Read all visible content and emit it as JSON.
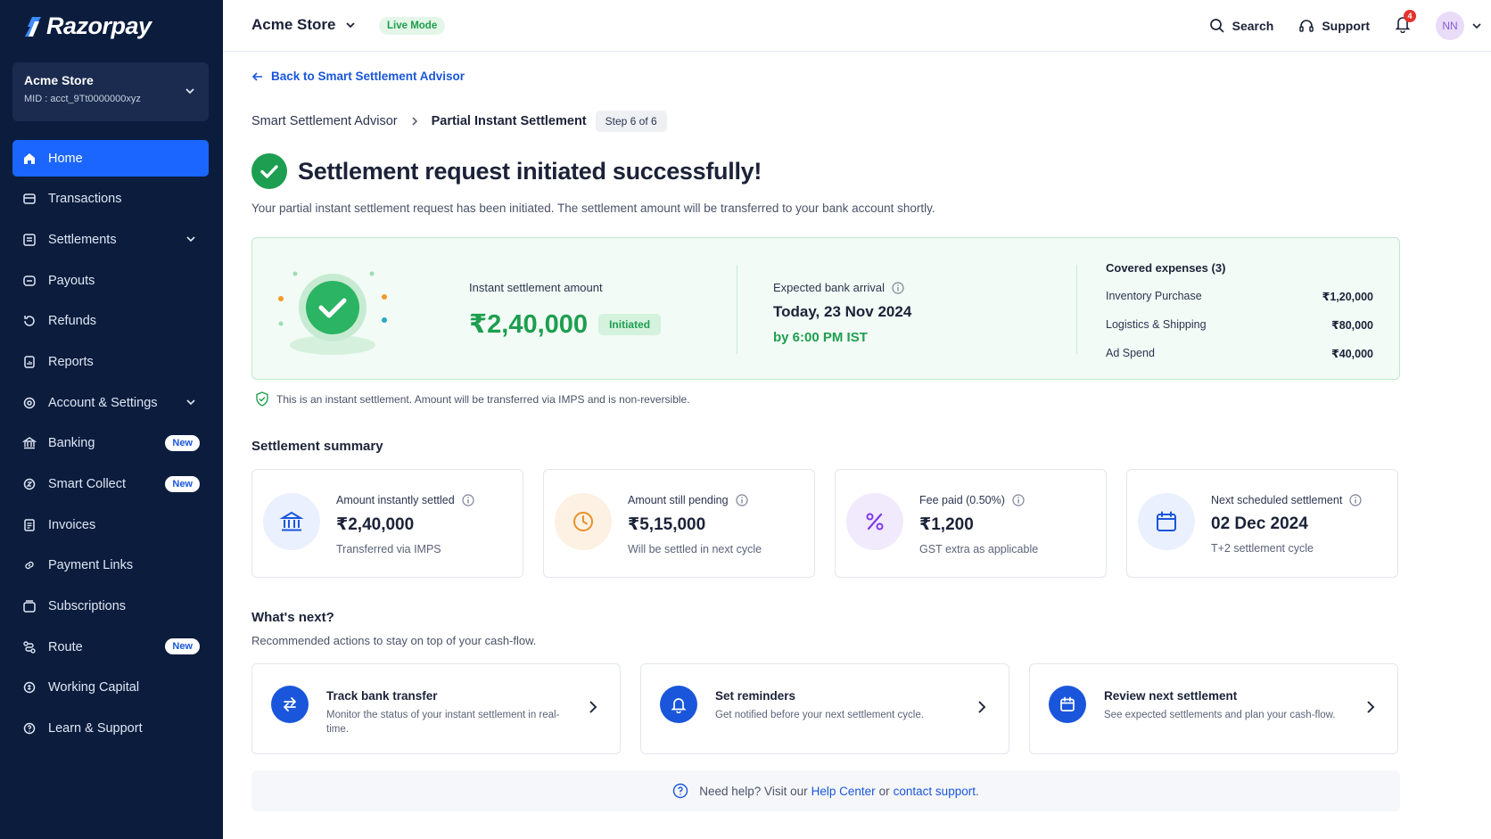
{
  "brand": {
    "name": "Razorpay"
  },
  "sidebar": {
    "store_name": "Acme Store",
    "store_mid": "MID : acct_9Tt0000000xyz",
    "items": [
      {
        "label": "Home",
        "icon": "home-icon",
        "active": true
      },
      {
        "label": "Transactions",
        "icon": "transactions-icon"
      },
      {
        "label": "Settlements",
        "icon": "settlements-icon",
        "expandable": true
      },
      {
        "label": "Payouts",
        "icon": "payouts-icon"
      },
      {
        "label": "Refunds",
        "icon": "refunds-icon"
      },
      {
        "label": "Reports",
        "icon": "reports-icon"
      },
      {
        "label": "Account & Settings",
        "icon": "settings-icon",
        "expandable": true
      },
      {
        "label": "Banking",
        "icon": "bank-icon",
        "badge": "New"
      },
      {
        "label": "Smart Collect",
        "icon": "smart-collect-icon",
        "badge": "New"
      },
      {
        "label": "Invoices",
        "icon": "invoice-icon"
      },
      {
        "label": "Payment Links",
        "icon": "link-icon"
      },
      {
        "label": "Subscriptions",
        "icon": "subscriptions-icon"
      },
      {
        "label": "Route",
        "icon": "route-icon",
        "badge": "New"
      },
      {
        "label": "Working Capital",
        "icon": "capital-icon"
      },
      {
        "label": "Learn & Support",
        "icon": "support-icon"
      }
    ]
  },
  "topbar": {
    "store_name": "Acme Store",
    "mode_badge": "Live Mode",
    "search_label": "Search",
    "support_label": "Support",
    "notification_count": "4",
    "avatar_initials": "NN"
  },
  "page": {
    "back_link": "Back to Smart Settlement Advisor",
    "breadcrumb": {
      "parent": "Smart Settlement Advisor",
      "current": "Partial Instant Settlement",
      "step": "Step 6 of 6"
    },
    "title": "Settlement request initiated successfully!",
    "subtitle": "Your partial instant settlement request has been initiated. The settlement amount will be transferred to your bank account shortly."
  },
  "hero": {
    "amount_label": "Instant settlement amount",
    "amount": "₹2,40,000",
    "status": "Initiated",
    "arrival_label": "Expected bank arrival",
    "arrival_date": "Today, 23 Nov 2024",
    "arrival_time": "by 6:00 PM IST",
    "expenses_label": "Covered expenses (3)",
    "expenses": [
      {
        "name": "Inventory Purchase",
        "amount": "₹1,20,000"
      },
      {
        "name": "Logistics & Shipping",
        "amount": "₹80,000"
      },
      {
        "name": "Ad Spend",
        "amount": "₹40,000"
      }
    ]
  },
  "note": "This is an instant settlement. Amount will be transferred via IMPS and is non-reversible.",
  "summary": {
    "title": "Settlement summary",
    "cards": [
      {
        "label": "Amount instantly settled",
        "value": "₹2,40,000",
        "sub": "Transferred via IMPS",
        "icon": "bank-icon",
        "bg": "#eaf0fd",
        "color": "#1a56db"
      },
      {
        "label": "Amount still pending",
        "value": "₹5,15,000",
        "sub": "Will be settled in next cycle",
        "icon": "clock-icon",
        "bg": "#fdf1e3",
        "color": "#e8912b"
      },
      {
        "label": "Fee paid (0.50%)",
        "value": "₹1,200",
        "sub": "GST extra as applicable",
        "icon": "percent-icon",
        "bg": "#f1eafc",
        "color": "#7c3aed"
      },
      {
        "label": "Next scheduled settlement",
        "value": "02 Dec 2024",
        "sub": "T+2 settlement cycle",
        "icon": "calendar-icon",
        "bg": "#eaf0fd",
        "color": "#1a56db"
      }
    ]
  },
  "next": {
    "title": "What's next?",
    "subtitle": "Recommended actions to stay on top of your cash-flow.",
    "actions": [
      {
        "title": "Track bank transfer",
        "desc": "Monitor the status of your instant settlement in real-time.",
        "icon": "transfer-icon"
      },
      {
        "title": "Set reminders",
        "desc": "Get notified before your next settlement cycle.",
        "icon": "bell-icon"
      },
      {
        "title": "Review next settlement",
        "desc": "See expected settlements and plan your cash-flow.",
        "icon": "calendar-icon"
      }
    ]
  },
  "help": {
    "prefix": "Need help? Visit our",
    "help_center": "Help Center",
    "or": "or",
    "contact": "contact support",
    "suffix": "."
  },
  "colors": {
    "sidebar_bg": "#0b1c3d",
    "accent": "#1a66ff",
    "success": "#1e9e50"
  }
}
